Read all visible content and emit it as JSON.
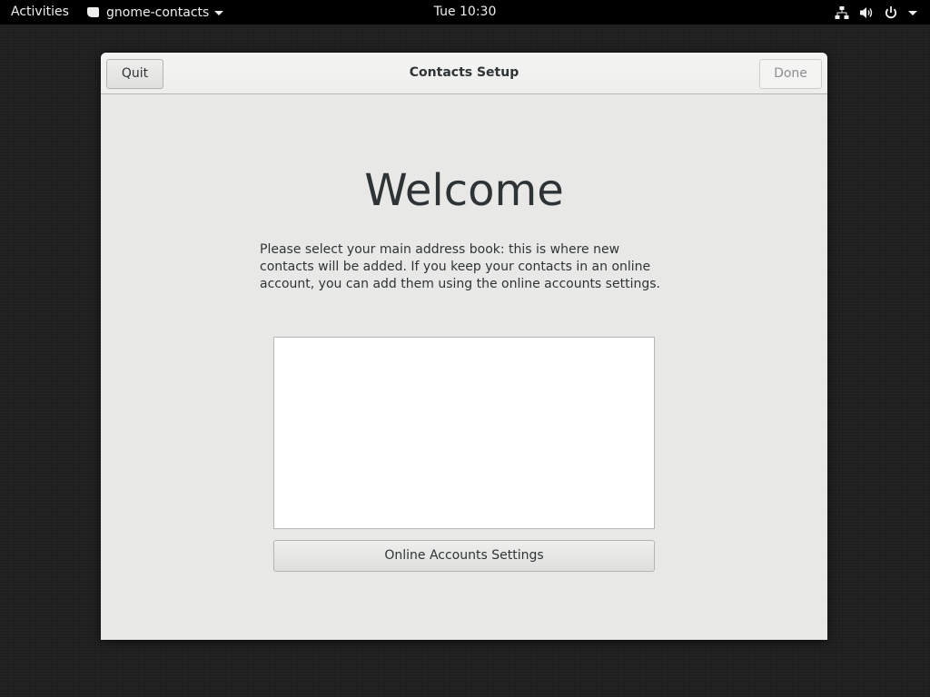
{
  "topbar": {
    "activities": "Activities",
    "app_menu": {
      "label": "gnome-contacts",
      "icon": "app-icon"
    },
    "clock": "Tue 10:30",
    "status_icons": [
      "network-wired-icon",
      "volume-icon",
      "power-icon",
      "menu-caret-icon"
    ]
  },
  "window": {
    "title": "Contacts Setup",
    "quit_label": "Quit",
    "done_label": "Done",
    "welcome": "Welcome",
    "description": "Please select your main address book: this is where new contacts will be added. If you keep your contacts in an online account, you can add them using the online accounts settings.",
    "online_accounts_label": "Online Accounts Settings",
    "address_books": []
  }
}
